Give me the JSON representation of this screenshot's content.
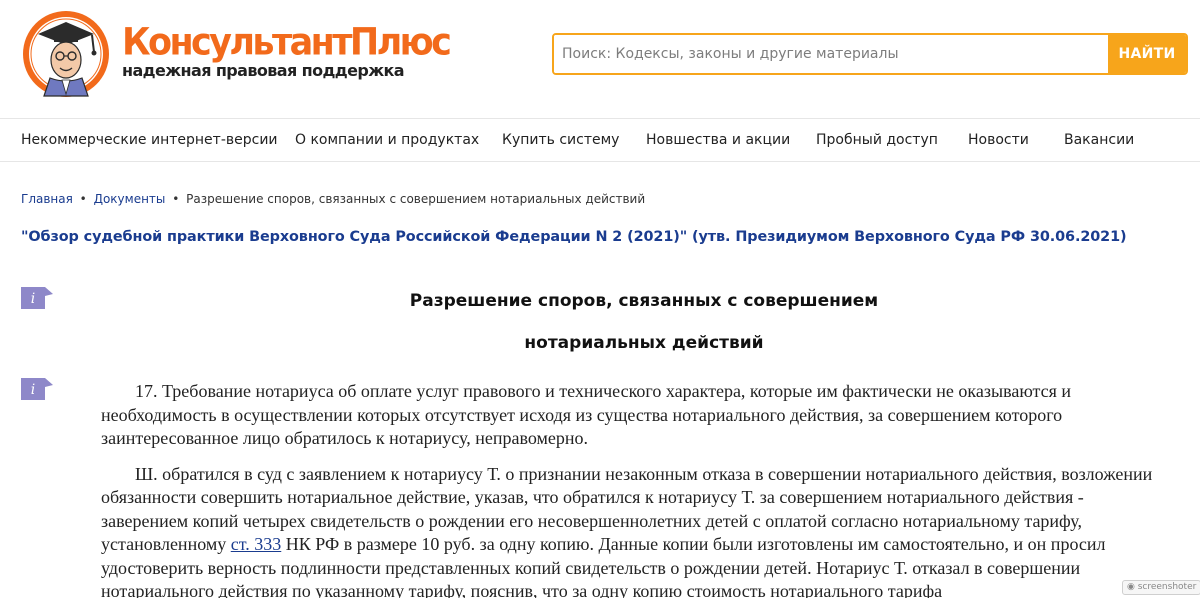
{
  "brand": {
    "name": "КонсультантПлюс",
    "tagline": "надежная правовая поддержка"
  },
  "search": {
    "placeholder": "Поиск: Кодексы, законы и другие материалы",
    "value": "",
    "button_label": "НАЙТИ"
  },
  "nav": {
    "items": [
      {
        "label": "Некоммерческие интернет-версии"
      },
      {
        "label": "О компании и продуктах"
      },
      {
        "label": "Купить систему"
      },
      {
        "label": "Новшества и акции"
      },
      {
        "label": "Пробный доступ"
      },
      {
        "label": "Новости"
      },
      {
        "label": "Вакансии"
      }
    ]
  },
  "breadcrumb": {
    "home": "Главная",
    "documents": "Документы",
    "current": "Разрешение споров, связанных с совершением нотариальных действий",
    "separator": "•"
  },
  "document": {
    "title": "\"Обзор судебной практики Верховного Суда Российской Федерации N 2 (2021)\" (утв. Президиумом Верховного Суда РФ 30.06.2021)",
    "heading_line1": "Разрешение споров, связанных с совершением",
    "heading_line2": "нотариальных действий",
    "info_icon_glyph": "i",
    "paragraph1": "17. Требование нотариуса об оплате услуг правового и технического характера, которые им фактически не оказываются и необходимость в осуществлении которых отсутствует исходя из существа нотариального действия, за совершением которого заинтересованное лицо обратилось к нотариусу, неправомерно.",
    "paragraph2_before_link": "Ш. обратился в суд с заявлением к нотариусу Т. о признании незаконным отказа в совершении нотариального действия, возложении обязанности совершить нотариальное действие, указав, что обратился к нотариусу Т. за совершением нотариального действия - заверением копий четырех свидетельств о рождении его несовершеннолетних детей с оплатой согласно нотариальному тарифу, установленному ",
    "paragraph2_link": "ст. 333",
    "paragraph2_after_link": " НК РФ в размере 10 руб. за одну копию. Данные копии были изготовлены им самостоятельно, и он просил удостоверить верность подлинности представленных копий свидетельств о рождении детей. Нотариус Т. отказал в совершении нотариального действия по указанному тарифу, пояснив, что за одну копию стоимость нотариального тарифа"
  },
  "watermark": "screenshoter",
  "colors": {
    "brand_orange": "#f26a1b",
    "search_accent": "#f7a51b",
    "link_blue": "#1a3c8f",
    "info_icon": "#8e88c9"
  }
}
